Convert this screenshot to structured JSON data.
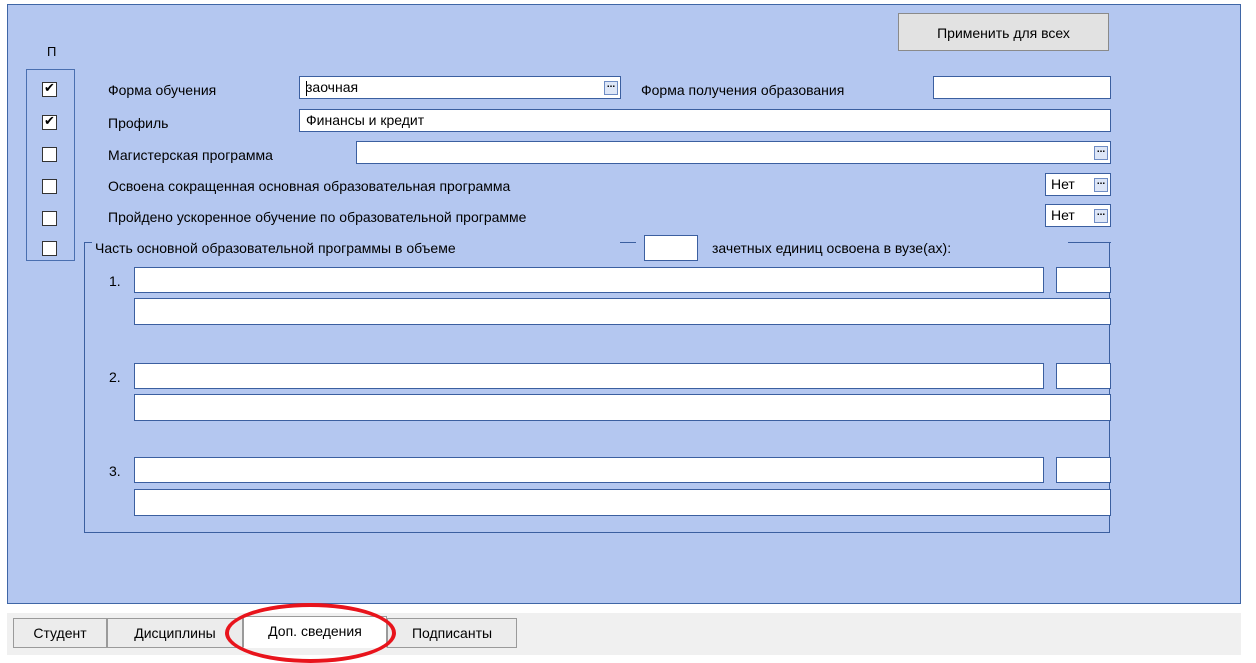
{
  "apply_button": "Применить для всех",
  "col_header": "П",
  "checkboxes": [
    true,
    true,
    false,
    false,
    false,
    false
  ],
  "form": {
    "study_form_label": "Форма обучения",
    "study_form_value": "заочная",
    "edu_form_label": "Форма получения образования",
    "edu_form_value": "",
    "profile_label": "Профиль",
    "profile_value": "Финансы и кредит",
    "master_label": "Магистерская программа",
    "master_value": "",
    "shortened_label": "Освоена сокращенная основная образовательная программа",
    "shortened_value": "Нет",
    "accelerated_label": "Пройдено ускоренное обучение по образовательной программе",
    "accelerated_value": "Нет",
    "part_label_before": "Часть основной образовательной программы в объеме",
    "part_units_value": "",
    "part_label_after": "зачетных единиц освоена в вузе(ах):"
  },
  "entries": [
    {
      "num": "1.",
      "name": "",
      "units": "",
      "note": ""
    },
    {
      "num": "2.",
      "name": "",
      "units": "",
      "note": ""
    },
    {
      "num": "3.",
      "name": "",
      "units": "",
      "note": ""
    }
  ],
  "ellipsis": "...",
  "tabs": [
    {
      "label": "Студент",
      "active": false
    },
    {
      "label": "Дисциплины",
      "active": false
    },
    {
      "label": "Доп. сведения",
      "active": true
    },
    {
      "label": "Подписанты",
      "active": false
    }
  ],
  "colors": {
    "panel": "#b4c7f0",
    "highlight_ring": "#e8141c"
  }
}
